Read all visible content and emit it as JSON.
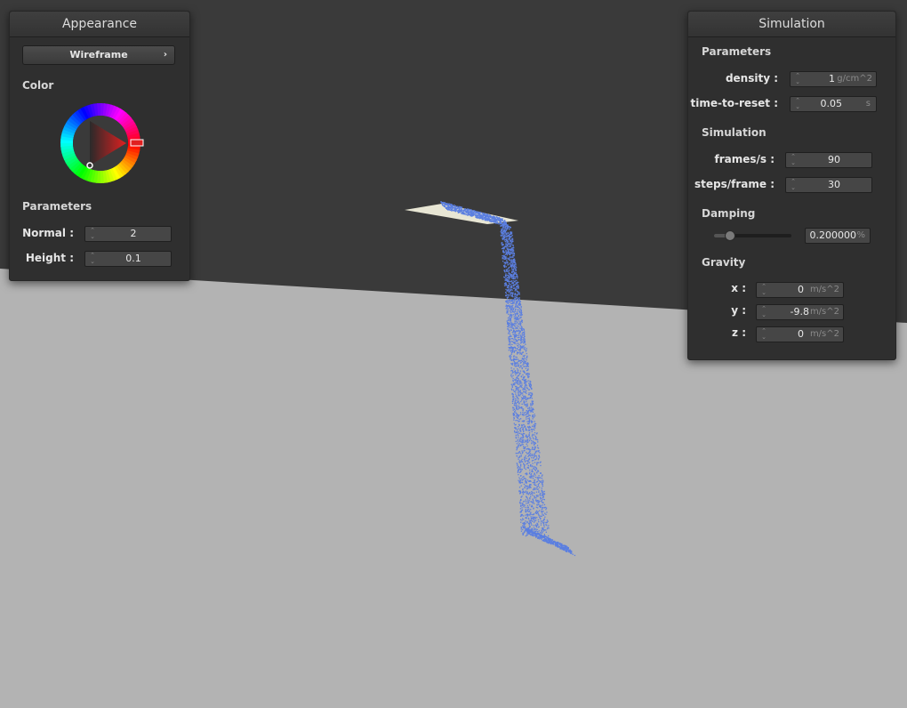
{
  "colors": {
    "floor": "#b3b3b3",
    "sky": "#3a3a3a",
    "particles": "#5b7fe0",
    "plate": "#e8e6d4",
    "panel_bg": "#2f2f2f",
    "picked_color": "#e02020"
  },
  "appearance": {
    "title": "Appearance",
    "mode_button": "Wireframe",
    "mode_button_icon": "chevron-right-icon",
    "color_section": "Color",
    "parameters_section": "Parameters",
    "normal_label": "Normal :",
    "normal_value": "2",
    "height_label": "Height :",
    "height_value": "0.1"
  },
  "simulation": {
    "title": "Simulation",
    "parameters_section": "Parameters",
    "density_label": "density :",
    "density_value": "1",
    "density_unit": "g/cm^2",
    "reset_label": "time-to-reset :",
    "reset_value": "0.05",
    "reset_unit": "s",
    "simulation_section": "Simulation",
    "fps_label": "frames/s :",
    "fps_value": "90",
    "steps_label": "steps/frame :",
    "steps_value": "30",
    "damping_section": "Damping",
    "damping_value": "0.200000",
    "damping_unit": "%",
    "damping_level": 0.2,
    "gravity_section": "Gravity",
    "gx_label": "x :",
    "gx_value": "0",
    "gy_label": "y :",
    "gy_value": "-9.8",
    "gz_label": "z :",
    "gz_value": "0",
    "gravity_unit": "m/s^2"
  }
}
